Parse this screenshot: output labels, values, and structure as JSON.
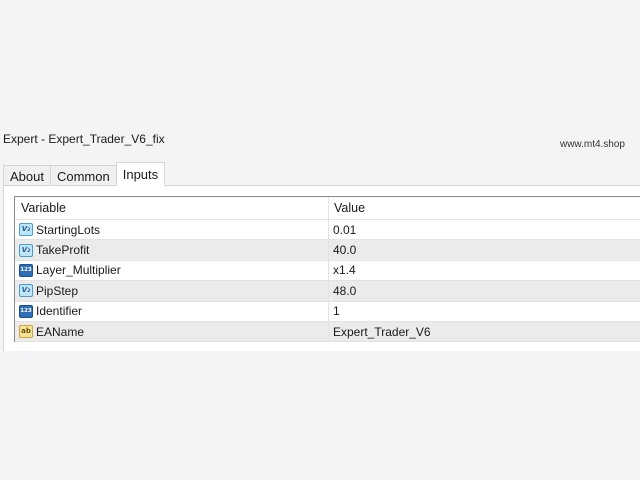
{
  "window": {
    "title": "Expert - Expert_Trader_V6_fix",
    "watermark": "www.mt4.shop"
  },
  "tabs": [
    {
      "label": "About",
      "active": false
    },
    {
      "label": "Common",
      "active": false
    },
    {
      "label": "Inputs",
      "active": true
    }
  ],
  "grid": {
    "headers": {
      "variable": "Variable",
      "value": "Value"
    },
    "rows": [
      {
        "type_icon": "double-type-icon",
        "icon_text": "V₂",
        "variable": "StartingLots",
        "value": "0.01"
      },
      {
        "type_icon": "double-type-icon",
        "icon_text": "V₂",
        "variable": "TakeProfit",
        "value": "40.0"
      },
      {
        "type_icon": "integer-type-icon",
        "icon_text": "123",
        "variable": "Layer_Multiplier",
        "value": "x1.4"
      },
      {
        "type_icon": "double-type-icon",
        "icon_text": "V₂",
        "variable": "PipStep",
        "value": "48.0"
      },
      {
        "type_icon": "integer-type-icon",
        "icon_text": "123",
        "variable": "Identifier",
        "value": "1"
      },
      {
        "type_icon": "string-type-icon",
        "icon_text": "ab",
        "variable": "EAName",
        "value": "Expert_Trader_V6"
      }
    ]
  },
  "colors": {
    "page_background": "#f3f4f6",
    "panel_background": "#ffffff",
    "alt_row_background": "#ebebeb",
    "grid_border": "#8a8a8a"
  }
}
